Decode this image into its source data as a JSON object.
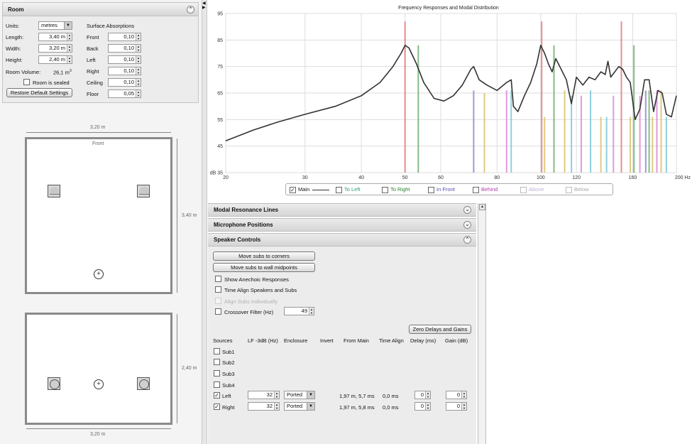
{
  "room": {
    "title": "Room",
    "units_label": "Units:",
    "units_value": "metres",
    "length_label": "Length:",
    "length_value": "3,40 m",
    "width_label": "Width:",
    "width_value": "3,20 m",
    "height_label": "Height:",
    "height_value": "2,40 m",
    "volume_label": "Room Volume:",
    "volume_value": "26,1 m",
    "volume_unit_sup": "3",
    "sealed_label": "Room is sealed",
    "restore_label": "Restore Default Settings",
    "absorptions_title": "Surface Absorptions",
    "surfaces": [
      {
        "label": "Front",
        "value": "0,10"
      },
      {
        "label": "Back",
        "value": "0,10"
      },
      {
        "label": "Left",
        "value": "0,10"
      },
      {
        "label": "Right",
        "value": "0,10"
      },
      {
        "label": "Ceiling",
        "value": "0,10"
      },
      {
        "label": "Floor",
        "value": "0,05"
      }
    ]
  },
  "plan": {
    "top_width_label": "3,20 m",
    "front_label": "Front",
    "length_label": "3,40 m",
    "side_height_label": "2,40 m",
    "bottom_width_label": "3,20 m"
  },
  "chart_data": {
    "type": "line",
    "title": "Frequency Responses and Modal Distribution",
    "x_scale": "log",
    "xlim": [
      20,
      200
    ],
    "ylim": [
      35,
      95
    ],
    "x_ticks": [
      "20",
      "30",
      "40",
      "50",
      "60",
      "80",
      "100",
      "120",
      "160",
      "200 Hz"
    ],
    "x_tick_values": [
      20,
      30,
      40,
      50,
      60,
      80,
      100,
      120,
      160,
      200
    ],
    "y_ticks": [
      "95",
      "85",
      "75",
      "65",
      "55",
      "45",
      "dB 35"
    ],
    "y_tick_values": [
      95,
      85,
      75,
      65,
      55,
      45,
      35
    ],
    "grid": true,
    "series": [
      {
        "name": "Main",
        "x": [
          20,
          23,
          26,
          30,
          35,
          40,
          44,
          47,
          49,
          50,
          51,
          53,
          55,
          58,
          61,
          64,
          67,
          70,
          71,
          73,
          76,
          80,
          84,
          86,
          87,
          89,
          92,
          95,
          98,
          100,
          102,
          104,
          106,
          108,
          111,
          114,
          117,
          120,
          124,
          128,
          132,
          136,
          139,
          141,
          143,
          146,
          149,
          152,
          155,
          158,
          162,
          166,
          170,
          174,
          178,
          182,
          186,
          190,
          195,
          200
        ],
        "values": [
          47,
          51,
          54,
          57,
          60,
          64,
          69,
          75,
          80,
          83,
          82,
          76,
          69,
          63,
          62,
          64,
          68,
          74,
          75,
          70,
          68,
          66,
          69,
          70,
          60,
          58,
          64,
          69,
          76,
          83,
          80,
          76,
          73,
          78,
          74,
          70,
          61,
          71,
          68,
          71,
          70,
          73,
          72,
          77,
          71,
          73,
          75,
          74,
          71,
          69,
          55,
          59,
          70,
          70,
          58,
          66,
          65,
          57,
          56,
          64
        ]
      }
    ],
    "mode_lines": [
      {
        "freq": 50,
        "color": "#e77a7a",
        "height": 92
      },
      {
        "freq": 53.5,
        "color": "#6fb06f",
        "height": 83
      },
      {
        "freq": 71,
        "color": "#8a8ad0",
        "height": 66
      },
      {
        "freq": 75,
        "color": "#d8c36a",
        "height": 65
      },
      {
        "freq": 84,
        "color": "#d98ad8",
        "height": 66
      },
      {
        "freq": 86,
        "color": "#7ac8d8",
        "height": 66
      },
      {
        "freq": 100.5,
        "color": "#e77a7a",
        "height": 92
      },
      {
        "freq": 102,
        "color": "#d8c36a",
        "height": 56
      },
      {
        "freq": 107,
        "color": "#6fb06f",
        "height": 83
      },
      {
        "freq": 113,
        "color": "#d8c36a",
        "height": 66
      },
      {
        "freq": 117,
        "color": "#7ac8d8",
        "height": 64
      },
      {
        "freq": 123,
        "color": "#d98ad8",
        "height": 64
      },
      {
        "freq": 129,
        "color": "#7ac8d8",
        "height": 66
      },
      {
        "freq": 136,
        "color": "#d8c36a",
        "height": 56
      },
      {
        "freq": 140,
        "color": "#7ac8d8",
        "height": 56
      },
      {
        "freq": 145,
        "color": "#d98ad8",
        "height": 64
      },
      {
        "freq": 151,
        "color": "#e77a7a",
        "height": 92
      },
      {
        "freq": 158,
        "color": "#d8c36a",
        "height": 56
      },
      {
        "freq": 161,
        "color": "#6fb06f",
        "height": 83
      },
      {
        "freq": 166,
        "color": "#d98ad8",
        "height": 64
      },
      {
        "freq": 171,
        "color": "#8a8ad0",
        "height": 66
      },
      {
        "freq": 174,
        "color": "#6fb06f",
        "height": 66
      },
      {
        "freq": 177,
        "color": "#d8c36a",
        "height": 56
      },
      {
        "freq": 181,
        "color": "#d98ad8",
        "height": 66
      },
      {
        "freq": 185,
        "color": "#d8c36a",
        "height": 66
      },
      {
        "freq": 190,
        "color": "#7ac8d8",
        "height": 56
      }
    ]
  },
  "legend": {
    "main": "Main",
    "to_left": "To Left",
    "to_right": "To Right",
    "in_front": "In Front",
    "behind": "Behind",
    "above": "Above",
    "below": "Below",
    "colors": {
      "main": "#333333",
      "to_left": "#2f9a7a",
      "to_right": "#2f7f2f",
      "in_front": "#5050b0",
      "behind": "#b040b0",
      "above": "#c0b0d8",
      "below": "#a8a8a8"
    }
  },
  "sections": {
    "modal": "Modal Resonance Lines",
    "mic": "Microphone Positions",
    "speaker": "Speaker Controls"
  },
  "controls": {
    "move_corners": "Move subs to corners",
    "move_midpoints": "Move subs to wall midpoints",
    "show_anechoic": "Show Anechoic Responses",
    "time_align": "Time Align Speakers and Subs",
    "align_subs": "Align Subs Individually",
    "crossover": "Crossover Filter (Hz)",
    "crossover_value": "49",
    "zero_delays": "Zero Delays and Gains"
  },
  "table": {
    "headers": [
      "Sources",
      "LF -3dB (Hz)",
      "Enclosure",
      "Invert",
      "From Main",
      "Time Align",
      "Delay (ms)",
      "Gain (dB)"
    ],
    "subs": [
      "Sub1",
      "Sub2",
      "Sub3",
      "Sub4"
    ],
    "rows": [
      {
        "name": "Left",
        "lf": "32",
        "enclosure": "Ported",
        "from_main": "1,97 m, 5,7 ms",
        "time_align": "0,0 ms",
        "delay": "0",
        "gain": "0"
      },
      {
        "name": "Right",
        "lf": "32",
        "enclosure": "Ported",
        "from_main": "1,97 m, 5,8 ms",
        "time_align": "0,0 ms",
        "delay": "0",
        "gain": "0"
      }
    ]
  }
}
